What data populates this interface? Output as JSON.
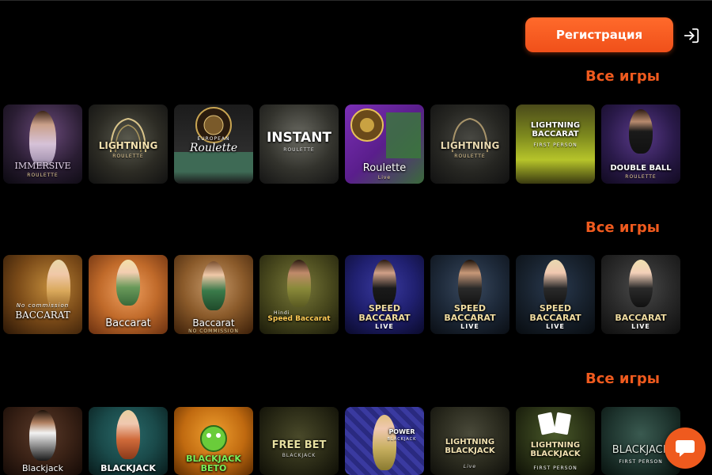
{
  "header": {
    "register_label": "Регистрация",
    "login_icon": "login-icon"
  },
  "colors": {
    "accent": "#ef5a1e",
    "background": "#000000"
  },
  "sections": [
    {
      "link_label": "Все игры",
      "tiles": [
        {
          "title": "IMMERSIVE",
          "subtitle": "ROULETTE"
        },
        {
          "title": "LIGHTNING",
          "subtitle": "ROULETTE"
        },
        {
          "title": "Roulette",
          "subtitle": "EUROPEAN"
        },
        {
          "title": "INSTANT",
          "subtitle": "ROULETTE"
        },
        {
          "title": "Roulette",
          "subtitle": "Live"
        },
        {
          "title": "LIGHTNING",
          "subtitle": "ROULETTE"
        },
        {
          "title": "LIGHTNING BACCARAT",
          "subtitle": "FIRST PERSON"
        },
        {
          "title": "DOUBLE BALL",
          "subtitle": "ROULETTE"
        }
      ]
    },
    {
      "link_label": "Все игры",
      "tiles": [
        {
          "title": "BACCARAT",
          "subtitle": "No commission"
        },
        {
          "title": "Baccarat",
          "subtitle": ""
        },
        {
          "title": "Baccarat",
          "subtitle": "NO COMMISSION"
        },
        {
          "title": "Speed Baccarat",
          "subtitle": "Hindi"
        },
        {
          "title": "SPEED BACCARAT",
          "subtitle": "LIVE"
        },
        {
          "title": "SPEED BACCARAT",
          "subtitle": "LIVE"
        },
        {
          "title": "SPEED BACCARAT",
          "subtitle": "LIVE"
        },
        {
          "title": "BACCARAT",
          "subtitle": "LIVE"
        }
      ]
    },
    {
      "link_label": "Все игры",
      "tiles": [
        {
          "title": "Blackjack",
          "subtitle": ""
        },
        {
          "title": "BLACKJACK",
          "subtitle": ""
        },
        {
          "title": "BLACKJACK BETO",
          "subtitle": ""
        },
        {
          "title": "FREE BET",
          "subtitle": "BLACKJACK"
        },
        {
          "title": "POWER",
          "subtitle": "BLACKJACK"
        },
        {
          "title": "LIGHTNING BLACKJACK",
          "subtitle": "Live"
        },
        {
          "title": "LIGHTNING BLACKJACK",
          "subtitle": "FIRST PERSON"
        },
        {
          "title": "BLACKJACK",
          "subtitle": "FIRST PERSON"
        }
      ]
    }
  ],
  "chat": {
    "icon": "chat-bubble-icon"
  }
}
